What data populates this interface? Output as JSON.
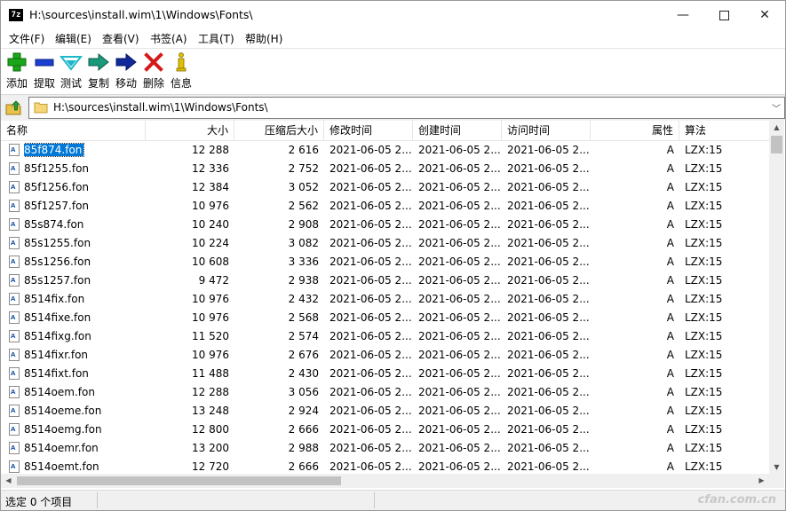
{
  "window": {
    "title": "H:\\sources\\install.wim\\1\\Windows\\Fonts\\",
    "app_icon_text": "7z"
  },
  "menu": [
    "文件(F)",
    "编辑(E)",
    "查看(V)",
    "书签(A)",
    "工具(T)",
    "帮助(H)"
  ],
  "toolbar": [
    {
      "label": "添加",
      "icon": "add-icon",
      "color": "#1aa51a"
    },
    {
      "label": "提取",
      "icon": "extract-icon",
      "color": "#1a3fd0"
    },
    {
      "label": "测试",
      "icon": "test-icon",
      "color": "#1fb8c9"
    },
    {
      "label": "复制",
      "icon": "copy-icon",
      "color": "#1a9a7a"
    },
    {
      "label": "移动",
      "icon": "move-icon",
      "color": "#102a9a"
    },
    {
      "label": "删除",
      "icon": "delete-icon",
      "color": "#d41a1a"
    },
    {
      "label": "信息",
      "icon": "info-icon",
      "color": "#e0c000"
    }
  ],
  "address": {
    "path": "H:\\sources\\install.wim\\1\\Windows\\Fonts\\"
  },
  "columns": [
    "名称",
    "大小",
    "压缩后大小",
    "修改时间",
    "创建时间",
    "访问时间",
    "属性",
    "算法"
  ],
  "files": [
    {
      "name": "85f874.fon",
      "size": "12 288",
      "packed": "2 616",
      "modified": "2021-06-05 2...",
      "created": "2021-06-05 2...",
      "accessed": "2021-06-05 2...",
      "attr": "A",
      "method": "LZX:15"
    },
    {
      "name": "85f1255.fon",
      "size": "12 336",
      "packed": "2 752",
      "modified": "2021-06-05 2...",
      "created": "2021-06-05 2...",
      "accessed": "2021-06-05 2...",
      "attr": "A",
      "method": "LZX:15"
    },
    {
      "name": "85f1256.fon",
      "size": "12 384",
      "packed": "3 052",
      "modified": "2021-06-05 2...",
      "created": "2021-06-05 2...",
      "accessed": "2021-06-05 2...",
      "attr": "A",
      "method": "LZX:15"
    },
    {
      "name": "85f1257.fon",
      "size": "10 976",
      "packed": "2 562",
      "modified": "2021-06-05 2...",
      "created": "2021-06-05 2...",
      "accessed": "2021-06-05 2...",
      "attr": "A",
      "method": "LZX:15"
    },
    {
      "name": "85s874.fon",
      "size": "10 240",
      "packed": "2 908",
      "modified": "2021-06-05 2...",
      "created": "2021-06-05 2...",
      "accessed": "2021-06-05 2...",
      "attr": "A",
      "method": "LZX:15"
    },
    {
      "name": "85s1255.fon",
      "size": "10 224",
      "packed": "3 082",
      "modified": "2021-06-05 2...",
      "created": "2021-06-05 2...",
      "accessed": "2021-06-05 2...",
      "attr": "A",
      "method": "LZX:15"
    },
    {
      "name": "85s1256.fon",
      "size": "10 608",
      "packed": "3 336",
      "modified": "2021-06-05 2...",
      "created": "2021-06-05 2...",
      "accessed": "2021-06-05 2...",
      "attr": "A",
      "method": "LZX:15"
    },
    {
      "name": "85s1257.fon",
      "size": "9 472",
      "packed": "2 938",
      "modified": "2021-06-05 2...",
      "created": "2021-06-05 2...",
      "accessed": "2021-06-05 2...",
      "attr": "A",
      "method": "LZX:15"
    },
    {
      "name": "8514fix.fon",
      "size": "10 976",
      "packed": "2 432",
      "modified": "2021-06-05 2...",
      "created": "2021-06-05 2...",
      "accessed": "2021-06-05 2...",
      "attr": "A",
      "method": "LZX:15"
    },
    {
      "name": "8514fixe.fon",
      "size": "10 976",
      "packed": "2 568",
      "modified": "2021-06-05 2...",
      "created": "2021-06-05 2...",
      "accessed": "2021-06-05 2...",
      "attr": "A",
      "method": "LZX:15"
    },
    {
      "name": "8514fixg.fon",
      "size": "11 520",
      "packed": "2 574",
      "modified": "2021-06-05 2...",
      "created": "2021-06-05 2...",
      "accessed": "2021-06-05 2...",
      "attr": "A",
      "method": "LZX:15"
    },
    {
      "name": "8514fixr.fon",
      "size": "10 976",
      "packed": "2 676",
      "modified": "2021-06-05 2...",
      "created": "2021-06-05 2...",
      "accessed": "2021-06-05 2...",
      "attr": "A",
      "method": "LZX:15"
    },
    {
      "name": "8514fixt.fon",
      "size": "11 488",
      "packed": "2 430",
      "modified": "2021-06-05 2...",
      "created": "2021-06-05 2...",
      "accessed": "2021-06-05 2...",
      "attr": "A",
      "method": "LZX:15"
    },
    {
      "name": "8514oem.fon",
      "size": "12 288",
      "packed": "3 056",
      "modified": "2021-06-05 2...",
      "created": "2021-06-05 2...",
      "accessed": "2021-06-05 2...",
      "attr": "A",
      "method": "LZX:15"
    },
    {
      "name": "8514oeme.fon",
      "size": "13 248",
      "packed": "2 924",
      "modified": "2021-06-05 2...",
      "created": "2021-06-05 2...",
      "accessed": "2021-06-05 2...",
      "attr": "A",
      "method": "LZX:15"
    },
    {
      "name": "8514oemg.fon",
      "size": "12 800",
      "packed": "2 666",
      "modified": "2021-06-05 2...",
      "created": "2021-06-05 2...",
      "accessed": "2021-06-05 2...",
      "attr": "A",
      "method": "LZX:15"
    },
    {
      "name": "8514oemr.fon",
      "size": "13 200",
      "packed": "2 988",
      "modified": "2021-06-05 2...",
      "created": "2021-06-05 2...",
      "accessed": "2021-06-05 2...",
      "attr": "A",
      "method": "LZX:15"
    },
    {
      "name": "8514oemt.fon",
      "size": "12 720",
      "packed": "2 666",
      "modified": "2021-06-05 2...",
      "created": "2021-06-05 2...",
      "accessed": "2021-06-05 2...",
      "attr": "A",
      "method": "LZX:15"
    }
  ],
  "status": {
    "text": "选定 0 个项目",
    "watermark": "cfan.com.cn"
  },
  "colors": {
    "selection": "#0078d7"
  }
}
